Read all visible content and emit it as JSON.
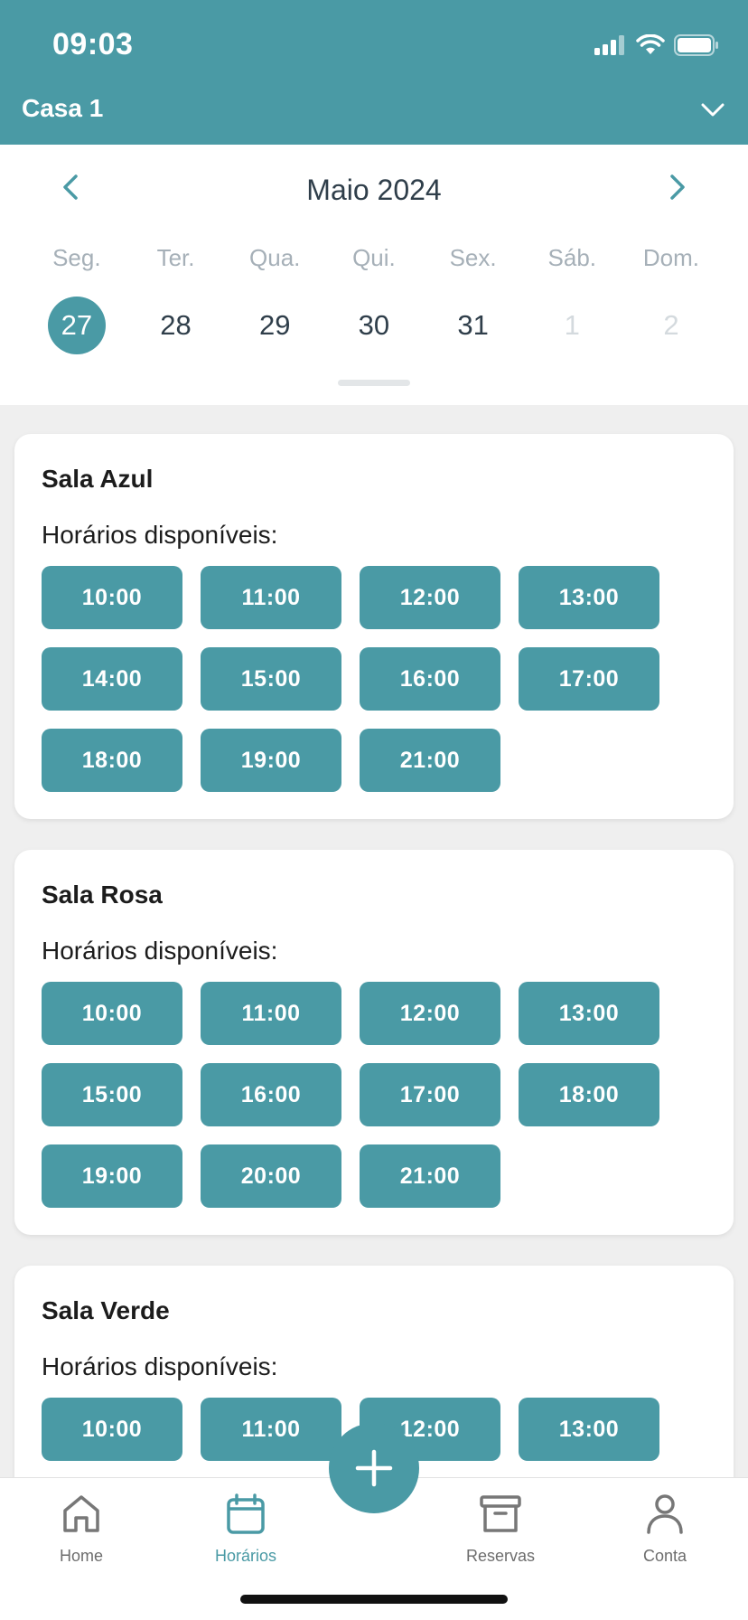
{
  "status_bar": {
    "time": "09:03"
  },
  "header": {
    "house_name": "Casa 1"
  },
  "calendar": {
    "month_label": "Maio 2024",
    "weekdays": [
      "Seg.",
      "Ter.",
      "Qua.",
      "Qui.",
      "Sex.",
      "Sáb.",
      "Dom."
    ],
    "days": [
      "27",
      "28",
      "29",
      "30",
      "31",
      "1",
      "2"
    ],
    "selected_day": "27"
  },
  "rooms": [
    {
      "name": "Sala Azul",
      "subtitle": "Horários disponíveis:",
      "slots": [
        "10:00",
        "11:00",
        "12:00",
        "13:00",
        "14:00",
        "15:00",
        "16:00",
        "17:00",
        "18:00",
        "19:00",
        "21:00"
      ]
    },
    {
      "name": "Sala Rosa",
      "subtitle": "Horários disponíveis:",
      "slots": [
        "10:00",
        "11:00",
        "12:00",
        "13:00",
        "15:00",
        "16:00",
        "17:00",
        "18:00",
        "19:00",
        "20:00",
        "21:00"
      ]
    },
    {
      "name": "Sala Verde",
      "subtitle": "Horários disponíveis:",
      "slots": [
        "10:00",
        "11:00",
        "12:00",
        "13:00"
      ]
    }
  ],
  "tabbar": {
    "home": "Home",
    "schedules": "Horários",
    "reservations": "Reservas",
    "account": "Conta",
    "active": "schedules"
  },
  "colors": {
    "accent": "#4a9aa5",
    "background": "#efefef",
    "muted_day": "#d4dade"
  },
  "icons": {
    "status": [
      "signal-icon",
      "wifi-icon",
      "battery-icon"
    ],
    "header": "chevron-down-icon",
    "calendar_prev": "chevron-left-icon",
    "calendar_next": "chevron-right-icon",
    "fab": "plus-icon",
    "tabs": [
      "home-icon",
      "calendar-icon",
      "archive-box-icon",
      "person-icon"
    ]
  }
}
